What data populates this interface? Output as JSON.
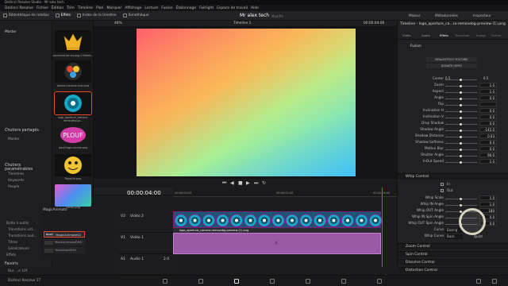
{
  "window": {
    "title": "DaVinci Resolve Studio - Mr alex tech"
  },
  "menu": [
    "DaVinci Resolve",
    "Fichier",
    "Édition",
    "Trim",
    "Timeline",
    "Plan",
    "Marquer",
    "Affichage",
    "Lecture",
    "Fusion",
    "Étalonnage",
    "Fairlight",
    "Espace de travail",
    "Aide"
  ],
  "toolbar": {
    "media_pool": "Bibliothèque de médias",
    "effects": "Effets",
    "edit_index": "Index de la timeline",
    "sound_library": "Sonothèque",
    "project_title": "Mr alex tech",
    "modified": "Modifié",
    "mixer": "Mixeur",
    "metadata": "Métadonnées",
    "inspector": "Inspecteur"
  },
  "left_panel": {
    "master": "Master",
    "shared_bins_title": "Chutiers partagés",
    "shared_master": "Master",
    "smart_bins_title": "Chutiers paramétrables",
    "smart_items": [
      "Timelines",
      "Keywords",
      "People"
    ],
    "toolbox_items": [
      "Boîte à outils",
      "Transitions vid...",
      "Transitions aud...",
      "Titres",
      "Générateurs",
      "Effets"
    ],
    "favorites": "Favoris",
    "fav_item": "Dur ...e 10f",
    "magic_title": "MagicAnimate",
    "magic_items": [
      "MagicAnimateV2",
      "MaskAnimateDHG",
      "TransitionDHG"
    ]
  },
  "thumbnails": [
    {
      "label": "couronne-de-roi.png-1-frame..."
    },
    {
      "label": "davinci-resolve-icon.png"
    },
    {
      "label": "logo_aperture_camera-removebg-pr..."
    },
    {
      "label": "plouf-logo-cuisine.png"
    },
    {
      "label": "Popsicle.png"
    },
    {
      "label": "lumen.png"
    }
  ],
  "viewer": {
    "zoom": "46%",
    "timeline_name": "Timeline 1",
    "timecode": "00:00:04:00"
  },
  "timeline": {
    "timecode": "00:00:04:00",
    "ruler_times": [
      "00:00:00:00",
      "00:00:02:00",
      "00:00:04:00"
    ],
    "tracks": [
      {
        "id": "V2",
        "name": "Vidéo 2"
      },
      {
        "id": "V1",
        "name": "Vidéo 1"
      },
      {
        "id": "A1",
        "name": "Audio 1",
        "level": "2.0"
      }
    ],
    "v2_clip_label": "logo_aperture_camera-removebg-preview (1).png"
  },
  "inspector": {
    "title": "Timeline - logo_aperture_ca...ra-removebg-preview (1).png",
    "tabs": [
      "Vidéo",
      "Audio",
      "Effets",
      "Transition",
      "Image",
      "Fichier"
    ],
    "subtab": "Fusion",
    "links": [
      "MRALEXTECH YOUTUBE",
      "DONATE HERE!"
    ],
    "params": [
      {
        "label": "Center",
        "val1": "0.5",
        "val2": "0.5"
      },
      {
        "label": "Zoom",
        "val": "1.0"
      },
      {
        "label": "Aspect",
        "val": "1.0"
      },
      {
        "label": "Angle",
        "val": "0.0"
      },
      {
        "label": "Flip",
        "val": ""
      },
      {
        "label": "Inclination H",
        "val": "0.0"
      },
      {
        "label": "Inclination V",
        "val": "0.0"
      },
      {
        "label": "Drop Shadow",
        "val": "0.0"
      },
      {
        "label": "Shadow Angle",
        "val": "-145.0"
      },
      {
        "label": "Shadow Distance",
        "val": "0.03"
      },
      {
        "label": "Shadow Softness",
        "val": "0.4"
      },
      {
        "label": "Motion Blur",
        "val": "0.0"
      },
      {
        "label": "Shutter Angle",
        "val": "90.0"
      },
      {
        "label": "InOut Speed",
        "val": "1.0"
      }
    ],
    "whip_title": "Whip Control",
    "whip_checks": [
      "In",
      "Out"
    ],
    "whip_params": [
      {
        "label": "Whip Scale",
        "val": "1.0"
      },
      {
        "label": "Whip IN Angle",
        "val": "1.0"
      },
      {
        "label": "Whip OUT Angle",
        "val": "180"
      },
      {
        "label": "Whip IN Spin Angle",
        "val": "0.0"
      },
      {
        "label": "Whip OUT Spin Angle",
        "val": "0.0"
      }
    ],
    "curve": {
      "label": "Curve",
      "value": "Easing"
    },
    "whip_curve": {
      "label": "Whip Curve",
      "value": "Back",
      "other": "Quint"
    },
    "sections": [
      "Zoom Control",
      "Spin Control",
      "Dissolve Control",
      "Distortion Control",
      "Mid Animation Control"
    ]
  },
  "status": {
    "app": "DaVinci Resolve 17"
  }
}
